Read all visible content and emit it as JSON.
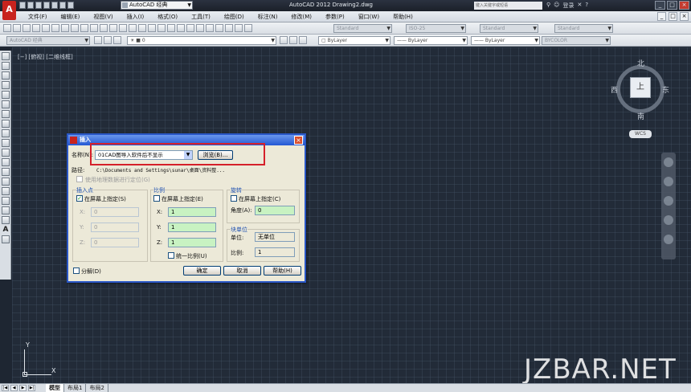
{
  "titlebar": {
    "logo": "A",
    "workspace": "AutoCAD 经典",
    "title": "AutoCAD 2012    Drawing2.dwg",
    "search_placeholder": "键入关键字或短语",
    "login": "登录",
    "buttons": [
      "_",
      "□",
      "×"
    ]
  },
  "menu": {
    "items": [
      "文件(F)",
      "编辑(E)",
      "视图(V)",
      "插入(I)",
      "格式(O)",
      "工具(T)",
      "绘图(D)",
      "标注(N)",
      "修改(M)",
      "参数(P)",
      "窗口(W)",
      "帮助(H)"
    ],
    "doc_buttons": [
      "_",
      "□",
      "×"
    ]
  },
  "toolbar1": {
    "text_style": "Standard",
    "dim_style": "ISO-25",
    "table_style": "Standard",
    "mleader_style": "Standard"
  },
  "toolbar2": {
    "workspace": "AutoCAD 经典",
    "layer": "0",
    "color": "ByLayer",
    "linetype": "ByLayer",
    "lineweight": "ByLayer",
    "plotstyle": "BYCOLOR"
  },
  "canvas": {
    "view_label": "[−] [俯视] [二维线框]",
    "compass": {
      "north": "北",
      "south": "南",
      "west": "西",
      "east": "东",
      "top": "上"
    },
    "wcs": "WCS",
    "ucs_x": "X",
    "ucs_y": "Y"
  },
  "watermark": "JZBAR.NET",
  "tabs": [
    "模型",
    "布局1",
    "布局2"
  ],
  "dialog": {
    "title": "插入",
    "name_label": "名称(N):",
    "name_value": "01CAD图导入软件后不显示",
    "browse": "浏览(B)...",
    "path_label": "路径:",
    "path_value": "C:\\Documents and Settings\\sunar\\桌面\\资料整...",
    "geo_check": "使用地理数据进行定位(G)",
    "insert_point": {
      "title": "插入点",
      "onscreen": "在屏幕上指定(S)",
      "x_label": "X:",
      "x": "0",
      "y_label": "Y:",
      "y": "0",
      "z_label": "Z:",
      "z": "0"
    },
    "scale": {
      "title": "比例",
      "onscreen": "在屏幕上指定(E)",
      "x_label": "X:",
      "x": "1",
      "y_label": "Y:",
      "y": "1",
      "z_label": "Z:",
      "z": "1",
      "uniform": "统一比例(U)"
    },
    "rotation": {
      "title": "旋转",
      "onscreen": "在屏幕上指定(C)",
      "angle_label": "角度(A):",
      "angle": "0"
    },
    "block_unit": {
      "title": "块单位",
      "unit_label": "单位:",
      "unit": "无单位",
      "factor_label": "比例:",
      "factor": "1"
    },
    "explode": "分解(D)",
    "ok": "确定",
    "cancel": "取消",
    "help": "帮助(H)"
  }
}
